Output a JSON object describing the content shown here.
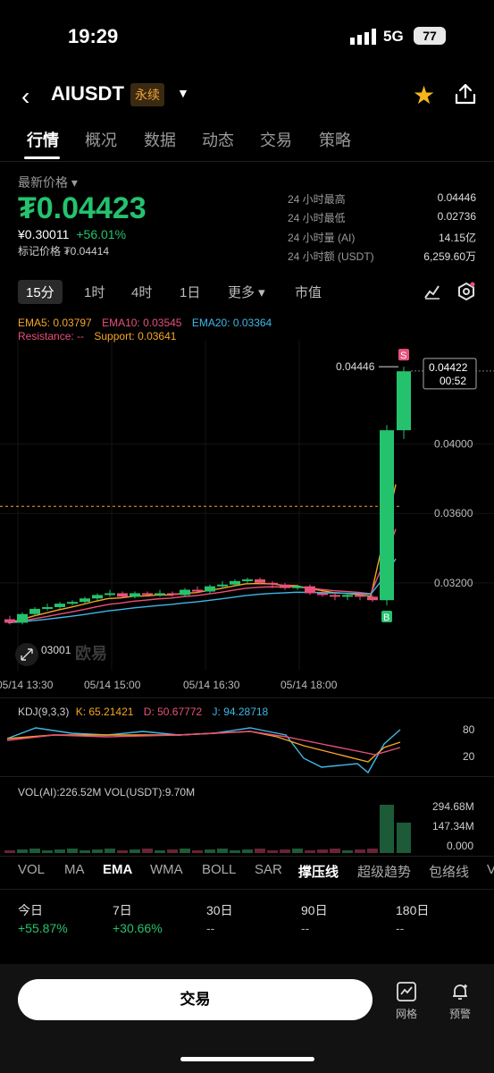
{
  "status_bar": {
    "time": "19:29",
    "network": "5G",
    "battery": "77"
  },
  "header": {
    "pair": "AIUSDT",
    "contract_type": "永续"
  },
  "tabs": [
    "行情",
    "概况",
    "数据",
    "动态",
    "交易",
    "策略"
  ],
  "price_section": {
    "label": "最新价格",
    "price": "₮0.04423",
    "fiat": "¥0.30011",
    "change": "+56.01%",
    "mark_price": "标记价格 ₮0.04414",
    "stats": [
      {
        "label": "24 小时最高",
        "value": "0.04446"
      },
      {
        "label": "24 小时最低",
        "value": "0.02736"
      },
      {
        "label": "24 小时量 (AI)",
        "value": "14.15亿"
      },
      {
        "label": "24 小时额 (USDT)",
        "value": "6,259.60万"
      }
    ]
  },
  "timeframes": [
    "15分",
    "1时",
    "4时",
    "1日",
    "更多",
    "市值"
  ],
  "chart": {
    "ema5": "EMA5: 0.03797",
    "ema10": "EMA10: 0.03545",
    "ema20": "EMA20: 0.03364",
    "resistance": "Resistance: --",
    "support": "Support: 0.03641",
    "high_label": "0.04446",
    "current_price_tag": "0.04422",
    "countdown": "00:52",
    "y_labels": [
      "0.04000",
      "0.03600",
      "0.03200"
    ],
    "x_labels": [
      "05/14 13:30",
      "05/14 15:00",
      "05/14 16:30",
      "05/14 18:00"
    ],
    "low_label": "03001",
    "watermark": "欧易",
    "sell_marker": "S",
    "buy_marker": "B"
  },
  "chart_data": {
    "type": "candlestick",
    "series": [
      {
        "name": "AIUSDT 15m",
        "candles": [
          {
            "o": 0.0299,
            "c": 0.0297,
            "h": 0.0301,
            "l": 0.0296
          },
          {
            "o": 0.0297,
            "c": 0.0302,
            "h": 0.0303,
            "l": 0.0296
          },
          {
            "o": 0.0302,
            "c": 0.0305,
            "h": 0.0306,
            "l": 0.0301
          },
          {
            "o": 0.0305,
            "c": 0.0306,
            "h": 0.0308,
            "l": 0.0304
          },
          {
            "o": 0.0306,
            "c": 0.0308,
            "h": 0.0309,
            "l": 0.0305
          },
          {
            "o": 0.0308,
            "c": 0.0309,
            "h": 0.031,
            "l": 0.0307
          },
          {
            "o": 0.0309,
            "c": 0.0311,
            "h": 0.0312,
            "l": 0.0308
          },
          {
            "o": 0.0311,
            "c": 0.0313,
            "h": 0.0314,
            "l": 0.031
          },
          {
            "o": 0.0313,
            "c": 0.0314,
            "h": 0.0316,
            "l": 0.0312
          },
          {
            "o": 0.0314,
            "c": 0.0312,
            "h": 0.0315,
            "l": 0.0311
          },
          {
            "o": 0.0312,
            "c": 0.0314,
            "h": 0.0315,
            "l": 0.0311
          },
          {
            "o": 0.0314,
            "c": 0.0313,
            "h": 0.0315,
            "l": 0.0312
          },
          {
            "o": 0.0313,
            "c": 0.0314,
            "h": 0.0316,
            "l": 0.0312
          },
          {
            "o": 0.0314,
            "c": 0.0313,
            "h": 0.0315,
            "l": 0.0312
          },
          {
            "o": 0.0313,
            "c": 0.0316,
            "h": 0.0317,
            "l": 0.0312
          },
          {
            "o": 0.0316,
            "c": 0.0315,
            "h": 0.0318,
            "l": 0.0314
          },
          {
            "o": 0.0315,
            "c": 0.0318,
            "h": 0.0319,
            "l": 0.0314
          },
          {
            "o": 0.0318,
            "c": 0.0319,
            "h": 0.0321,
            "l": 0.0317
          },
          {
            "o": 0.0319,
            "c": 0.0321,
            "h": 0.0322,
            "l": 0.0318
          },
          {
            "o": 0.0321,
            "c": 0.0322,
            "h": 0.0323,
            "l": 0.032
          },
          {
            "o": 0.0322,
            "c": 0.032,
            "h": 0.0323,
            "l": 0.0319
          },
          {
            "o": 0.032,
            "c": 0.0319,
            "h": 0.0321,
            "l": 0.0317
          },
          {
            "o": 0.0319,
            "c": 0.0317,
            "h": 0.032,
            "l": 0.0316
          },
          {
            "o": 0.0317,
            "c": 0.0318,
            "h": 0.0319,
            "l": 0.0316
          },
          {
            "o": 0.0318,
            "c": 0.0314,
            "h": 0.0319,
            "l": 0.0313
          },
          {
            "o": 0.0314,
            "c": 0.0313,
            "h": 0.0315,
            "l": 0.0312
          },
          {
            "o": 0.0313,
            "c": 0.0312,
            "h": 0.0314,
            "l": 0.031
          },
          {
            "o": 0.0312,
            "c": 0.0313,
            "h": 0.0314,
            "l": 0.031
          },
          {
            "o": 0.0313,
            "c": 0.0312,
            "h": 0.0314,
            "l": 0.031
          },
          {
            "o": 0.0312,
            "c": 0.031,
            "h": 0.0313,
            "l": 0.0309
          },
          {
            "o": 0.031,
            "c": 0.0408,
            "h": 0.0411,
            "l": 0.0307
          },
          {
            "o": 0.0408,
            "c": 0.0442,
            "h": 0.04446,
            "l": 0.0403
          }
        ]
      }
    ],
    "xlabels": [
      "05/14 13:30",
      "05/14 15:00",
      "05/14 16:30",
      "05/14 18:00"
    ],
    "ylim": [
      0.029,
      0.0455
    ]
  },
  "kdj": {
    "label": "KDJ(9,3,3)",
    "k": "K: 65.21421",
    "d": "D: 50.67772",
    "j": "J: 94.28718",
    "levels": [
      "80",
      "20"
    ]
  },
  "volume": {
    "legend": "VOL(AI):226.52M  VOL(USDT):9.70M",
    "y_labels": [
      "294.68M",
      "147.34M",
      "0.000"
    ]
  },
  "indicator_tabs": [
    "VOL",
    "MA",
    "EMA",
    "WMA",
    "BOLL",
    "SAR",
    "撑压线",
    "超级趋势",
    "包络线",
    "V"
  ],
  "performance": [
    {
      "label": "今日",
      "value": "+55.87%"
    },
    {
      "label": "7日",
      "value": "+30.66%"
    },
    {
      "label": "30日",
      "value": "--"
    },
    {
      "label": "90日",
      "value": "--"
    },
    {
      "label": "180日",
      "value": "--"
    }
  ],
  "bottom": {
    "trade": "交易",
    "grid": "网格",
    "alert": "预警"
  },
  "colors": {
    "up": "#25c26e",
    "down": "#e8517a",
    "ema5": "#f5a623",
    "ema10": "#e8517a",
    "ema20": "#3fb8e6"
  }
}
